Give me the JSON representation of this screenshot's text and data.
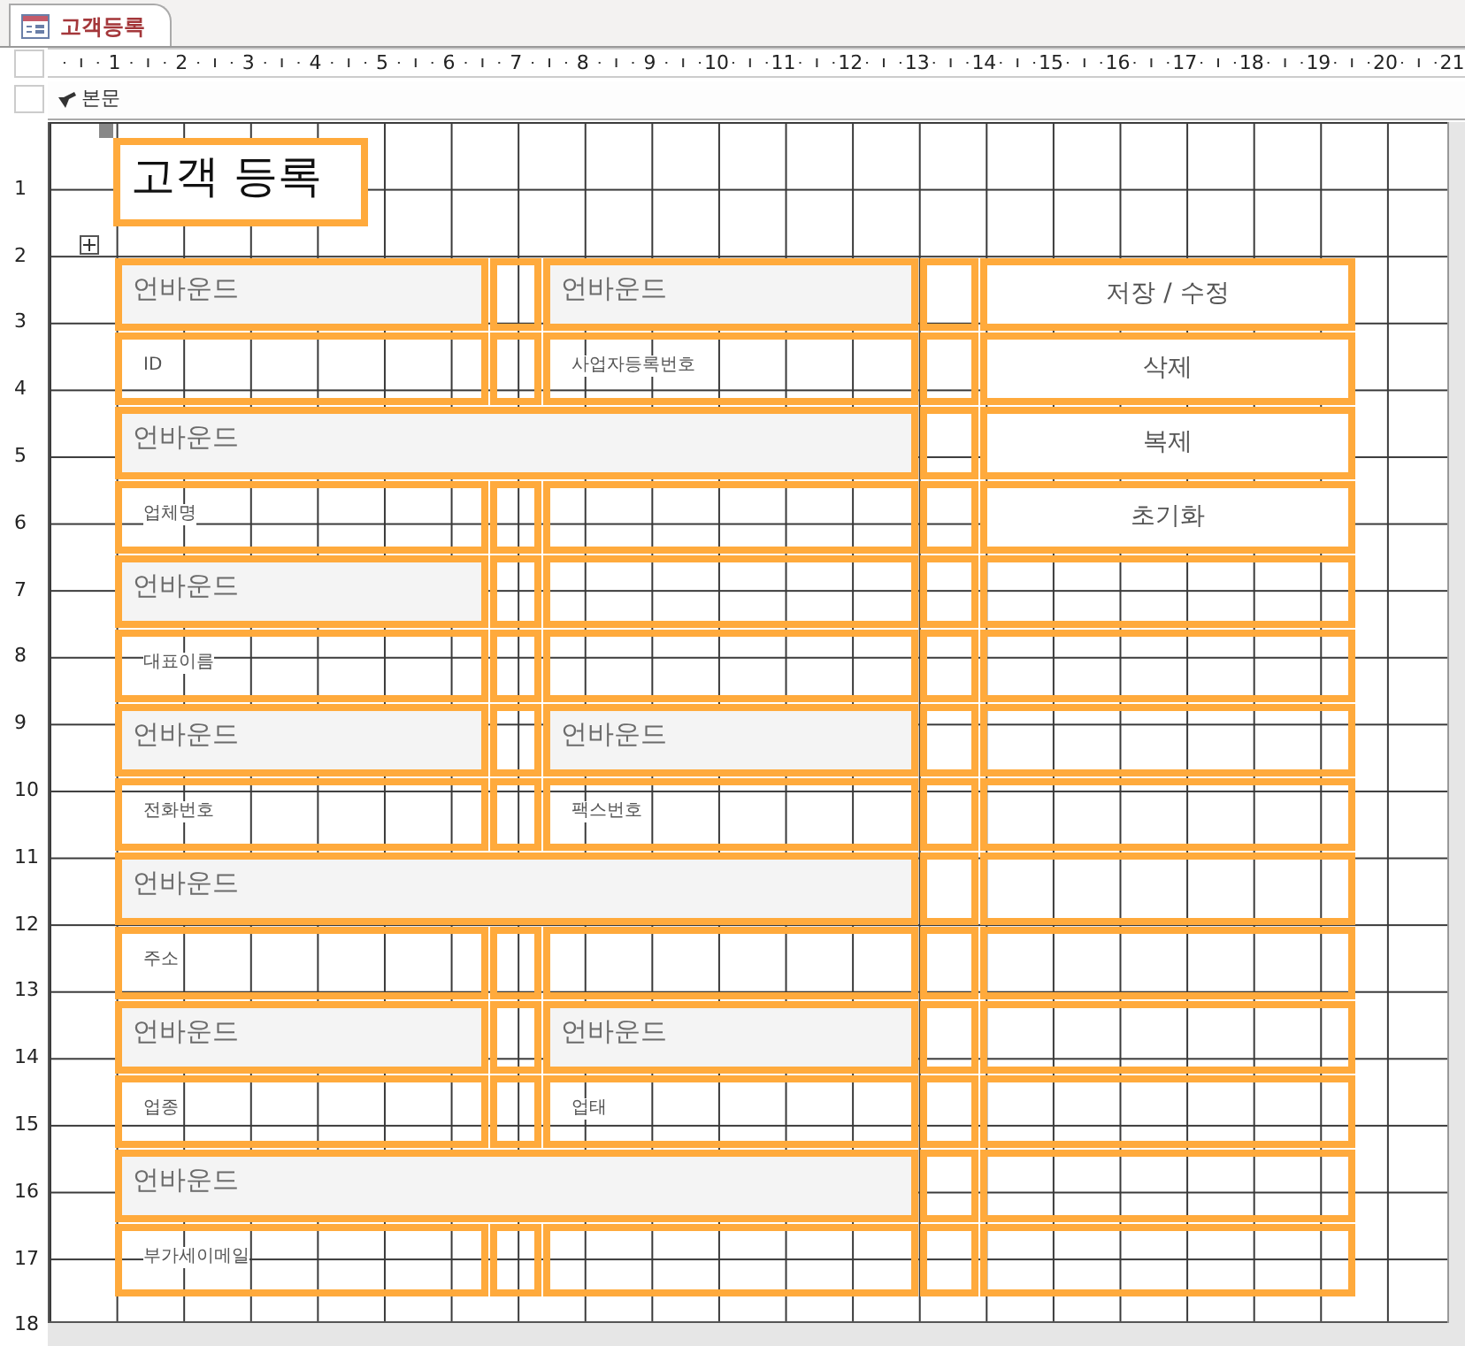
{
  "tab": {
    "title": "고객등록"
  },
  "ruler": {
    "horizontal": [
      "1",
      "2",
      "3",
      "4",
      "5",
      "6",
      "7",
      "8",
      "9",
      "10",
      "11",
      "12",
      "13",
      "14",
      "15",
      "16",
      "17",
      "18",
      "19",
      "20",
      "21"
    ],
    "vertical": [
      "1",
      "2",
      "3",
      "4",
      "5",
      "6",
      "7",
      "8",
      "9",
      "10",
      "11",
      "12",
      "13",
      "14",
      "15",
      "16",
      "17",
      "18"
    ]
  },
  "section": {
    "title": "본문"
  },
  "form_title": "고객 등록",
  "rows": [
    {
      "left": {
        "kind": "textbox",
        "text": "언바운드"
      },
      "right": {
        "kind": "textbox",
        "text": "언바운드"
      },
      "action": {
        "kind": "button",
        "label": "저장 / 수정"
      }
    },
    {
      "left": {
        "kind": "label",
        "text": "ID"
      },
      "right": {
        "kind": "label",
        "text": "사업자등록번호"
      },
      "action": {
        "kind": "button",
        "label": "삭제"
      }
    },
    {
      "left": {
        "kind": "wide_textbox",
        "text": "언바운드"
      },
      "action": {
        "kind": "button",
        "label": "복제"
      }
    },
    {
      "left": {
        "kind": "label",
        "text": "업체명"
      },
      "action": {
        "kind": "button",
        "label": "초기화"
      }
    },
    {
      "left": {
        "kind": "textbox",
        "text": "언바운드"
      }
    },
    {
      "left": {
        "kind": "label",
        "text": "대표이름"
      }
    },
    {
      "left": {
        "kind": "textbox",
        "text": "언바운드"
      },
      "right": {
        "kind": "textbox",
        "text": "언바운드"
      }
    },
    {
      "left": {
        "kind": "label",
        "text": "전화번호"
      },
      "right": {
        "kind": "label",
        "text": "팩스번호"
      }
    },
    {
      "left": {
        "kind": "wide_textbox",
        "text": "언바운드"
      }
    },
    {
      "left": {
        "kind": "label",
        "text": "주소"
      }
    },
    {
      "left": {
        "kind": "textbox",
        "text": "언바운드"
      },
      "right": {
        "kind": "textbox",
        "text": "언바운드"
      }
    },
    {
      "left": {
        "kind": "label",
        "text": "업종"
      },
      "right": {
        "kind": "label",
        "text": "업태"
      }
    },
    {
      "left": {
        "kind": "wide_textbox",
        "text": "언바운드"
      }
    },
    {
      "left": {
        "kind": "label",
        "text": "부가세이메일"
      }
    }
  ]
}
